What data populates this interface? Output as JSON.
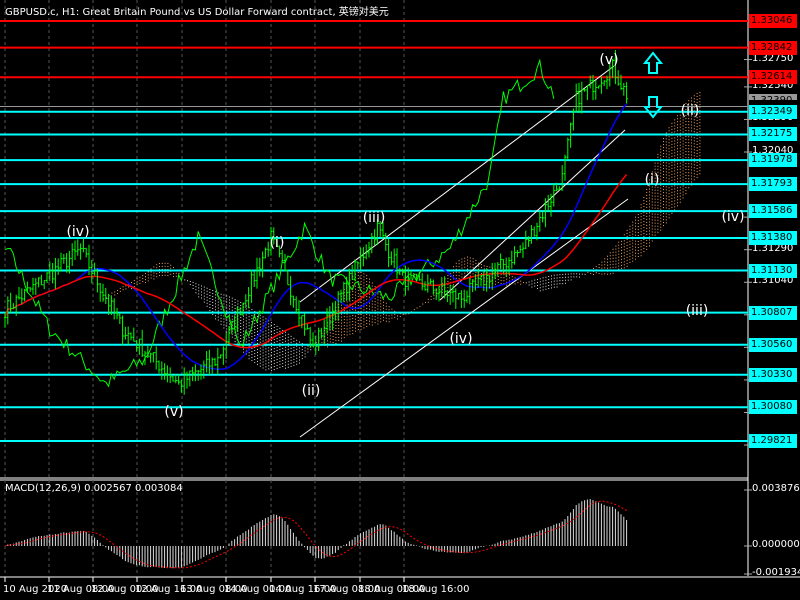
{
  "header": {
    "title": "GBPUSD.c, H1:  Great Britain Pound vs US Dollar Forward contract, 英镑对美元"
  },
  "macd": {
    "label": "MACD(12,26,9) 0.002567 0.003084",
    "axis": [
      "0.003876",
      "0.000000",
      "-0.001934"
    ]
  },
  "levels": [
    {
      "price": "1.33046",
      "color": "#ff0000"
    },
    {
      "price": "1.32842",
      "color": "#ff0000"
    },
    {
      "price": "1.32614",
      "color": "#ff0000"
    },
    {
      "price": "1.32349",
      "color": "#00ffff"
    },
    {
      "price": "1.32175",
      "color": "#00ffff"
    },
    {
      "price": "1.31978",
      "color": "#00ffff"
    },
    {
      "price": "1.31793",
      "color": "#00ffff"
    },
    {
      "price": "1.31586",
      "color": "#00ffff"
    },
    {
      "price": "1.31380",
      "color": "#00ffff"
    },
    {
      "price": "1.31130",
      "color": "#00ffff"
    },
    {
      "price": "1.30807",
      "color": "#00ffff"
    },
    {
      "price": "1.30560",
      "color": "#00ffff"
    },
    {
      "price": "1.30330",
      "color": "#00ffff"
    },
    {
      "price": "1.30080",
      "color": "#00ffff"
    },
    {
      "price": "1.29821",
      "color": "#00ffff"
    }
  ],
  "price_axis": [
    "1.32750",
    "1.32540",
    "1.32290",
    "1.32040",
    "1.31540",
    "1.31290",
    "1.31040",
    "1.30790",
    "1.30540",
    "1.30290",
    "1.30040",
    "1.29790"
  ],
  "bid": "1.32390",
  "time_axis": [
    "10 Aug 2020",
    "11 Aug 08:00",
    "12 Aug 00:00",
    "12 Aug 16:00",
    "13 Aug 08:00",
    "14 Aug 00:00",
    "14 Aug 16:00",
    "17 Aug 08:00",
    "18 Aug 00:00",
    "18 Aug 16:00"
  ],
  "waves": [
    "(iv)",
    "(v)",
    "(i)",
    "(ii)",
    "(iii)",
    "(iv)",
    "(v)",
    "(ii)",
    "(i)",
    "(iv)",
    "(iii)"
  ],
  "chart_data": {
    "type": "line",
    "title": "GBPUSD.c H1",
    "close_keypoints": [
      [
        0,
        1.3083
      ],
      [
        27,
        1.3129
      ],
      [
        42,
        1.3068
      ],
      [
        62,
        1.3026
      ],
      [
        76,
        1.3045
      ],
      [
        95,
        1.3138
      ],
      [
        106,
        1.3077
      ],
      [
        110,
        1.3054
      ],
      [
        133,
        1.3146
      ],
      [
        142,
        1.3107
      ],
      [
        163,
        1.3092
      ],
      [
        185,
        1.313
      ],
      [
        199,
        1.3184
      ],
      [
        204,
        1.3245
      ],
      [
        217,
        1.3269
      ],
      [
        222,
        1.3248
      ]
    ],
    "ylim": [
      1.296,
      1.332
    ]
  }
}
